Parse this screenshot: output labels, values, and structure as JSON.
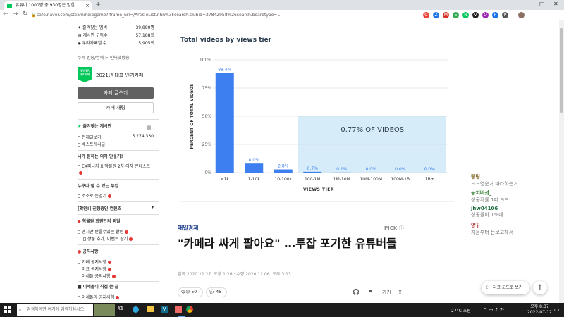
{
  "browser": {
    "tab_title": "유튜버 1000명 중 930명은 망한...",
    "new_tab": "+",
    "url": "cafe.naver.com/steamindiegame?iframe_url=/ArticleList.nhn%3Fsearch.clubid=27842958%26search.boardtype=L",
    "window_controls": [
      "−",
      "□",
      "✕"
    ],
    "extensions": [
      {
        "label": "G",
        "color": "#ea4335"
      },
      {
        "label": "Z",
        "color": "#1a73e8"
      },
      {
        "label": "M",
        "color": "#d93025"
      },
      {
        "label": "E",
        "color": "#34a853"
      },
      {
        "label": "N",
        "color": "#03c75a"
      },
      {
        "label": "V",
        "color": "#222222"
      },
      {
        "label": "O",
        "color": "#9c27b0"
      },
      {
        "label": "F",
        "color": "#1a73e8"
      },
      {
        "label": "P",
        "color": "#555555"
      }
    ]
  },
  "sidebar": {
    "stats": [
      {
        "label": "즐겨찾는 멤버",
        "value": "39,880명"
      },
      {
        "label": "게시판 구독수",
        "value": "57,188회"
      },
      {
        "label": "우리카페앱 수",
        "value": "5,905회"
      }
    ],
    "topic": "주제  방송/연예 > 인터넷방송",
    "badge_top": "NAVER",
    "badge_bottom": "대표카페",
    "badge_text": "2021년 대표 인기카페",
    "write_button": "카페 글쓰기",
    "chat_button": "카페 채팅",
    "fav_boards": "즐겨찾는 게시판",
    "all_posts": "전체글보기",
    "all_posts_count": "5,274,330",
    "best_posts": "베스트게시글",
    "sec1": "내가 원하는 의자 만들기?",
    "sec1_item": "EX파니자 X 막물원 2차 의자 콘테스트",
    "sec2": "누구나 할 수 있는 부업",
    "sec2_item": "소소로 돈벌기",
    "sec3": "[확인!] 진행중인 컨텐츠",
    "sec4": "학물원 회원만의 비밀",
    "sec4_item1": "맨치만 받을수있는 할인",
    "sec4_item2": "상품 추가, 이벤트 장기",
    "sec5": "공지사항",
    "sec5_item1": "카페 공지사항",
    "sec5_item2": "미크 공지사항",
    "sec5_item3": "이세돌 공지사항",
    "sec6": "이세돌이 직접 쓴 글",
    "sec6_item": "이세돌의 공지사항"
  },
  "chart_data": {
    "type": "bar",
    "title": "Total videos by views tier",
    "xlabel": "VIEWS TIER",
    "ylabel": "PERCENT OF TOTAL VIDEOS",
    "ylim": [
      0,
      100
    ],
    "yticks": [
      "0%",
      "25%",
      "50%",
      "75%",
      "100%"
    ],
    "categories": [
      "<1k",
      "1-10k",
      "10-100k",
      "100-1M",
      "1M-10M",
      "10M-100M",
      "100M-1B",
      "1B+"
    ],
    "values": [
      88.4,
      8.0,
      2.8,
      0.7,
      0.1,
      0.0,
      0.0,
      0.0
    ],
    "value_labels": [
      "88.4%",
      "8.0%",
      "2.8%",
      "0.7%",
      "0.1%",
      "0.0%",
      "0.0%",
      "0.0%"
    ],
    "highlight_label": "0.77% OF VIDEOS",
    "bar_color": "#3d7ff0",
    "highlight_color": "#d6ecf8",
    "grid": true
  },
  "article": {
    "source": "매일경제",
    "pick": "PICK",
    "headline": "\"카메라 싸게 팔아요\" …투잡 포기한 유튜버들",
    "meta": "입력 2020.11.27. 오후 1:26 · 수정 2020.12.06. 오후 3:13",
    "reactions_count": "50",
    "comments_count": "45"
  },
  "chat": [
    {
      "name": "링링",
      "msg": "ㅋㅋ영순거 따라하는거",
      "color": "#7c5c1a"
    },
    {
      "name": "농지버섯_",
      "msg": "성공확률 1퍼 ㅋㅋ",
      "color": "#2a7a2a"
    },
    {
      "name": "jhw04106",
      "msg": "성공률이 1%네",
      "color": "#1a6a3a"
    },
    {
      "name": "양꾸_",
      "msg": "처음부터 돈보고해서",
      "color": "#b03030"
    }
  ],
  "buttons": {
    "darkmode": "다크 모드로 보기",
    "totop": "↑"
  },
  "taskbar": {
    "search_placeholder": "검색하려면 여기에 입력하십시오.",
    "weather": "27°C 흐림",
    "time": "오후 8:37",
    "date": "2022-07-12"
  }
}
